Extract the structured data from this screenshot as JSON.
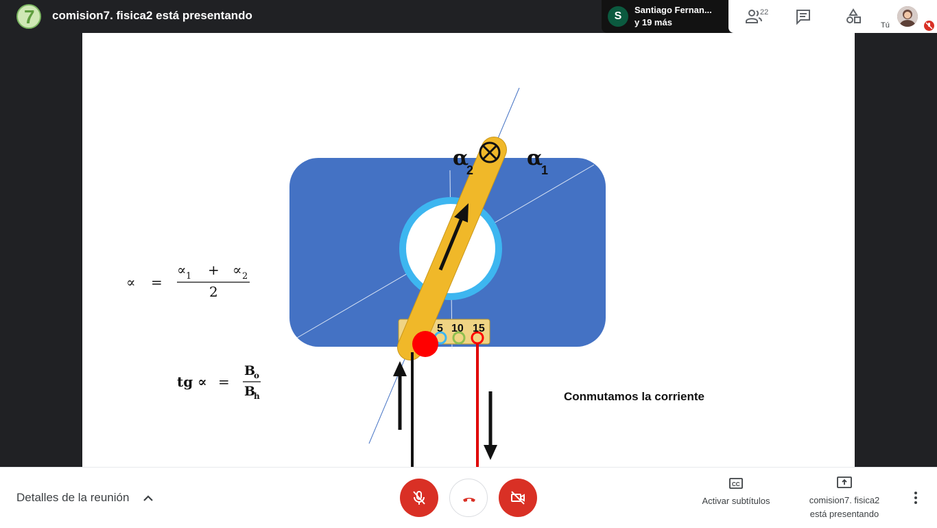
{
  "header": {
    "title": "comision7. fisica2 está presentando",
    "logo_glyph": "7"
  },
  "participant": {
    "initial": "S",
    "name": "Santiago Fernan...",
    "more": "y 19 más"
  },
  "toolbar": {
    "people_count": "22",
    "self_label": "Tú"
  },
  "slide": {
    "alpha": "α",
    "alpha2_sub": "2",
    "alpha1_sub": "1",
    "terminal_labels": [
      "5",
      "10",
      "15"
    ],
    "caption": "Conmutamos la corriente",
    "formula1": {
      "lhs": "∝",
      "equals": "=",
      "num_a": "∝",
      "num_a_sub": "1",
      "plus": "+",
      "num_b": "∝",
      "num_b_sub": "2",
      "den": "2"
    },
    "formula2": {
      "lhs": "tg ∝",
      "equals": "=",
      "num": "B",
      "num_sub": "o",
      "den": "B",
      "den_sub": "h"
    }
  },
  "bottom": {
    "details_label": "Detalles de la reunión",
    "captions_label": "Activar subtítulos",
    "present_line1": "comision7. fisica2",
    "present_line2": "está presentando"
  },
  "colors": {
    "blue_board": "#4472c4",
    "ring": "#3db6f0",
    "needle": "#f0b829",
    "red": "#ff0000",
    "danger": "#d93025"
  }
}
